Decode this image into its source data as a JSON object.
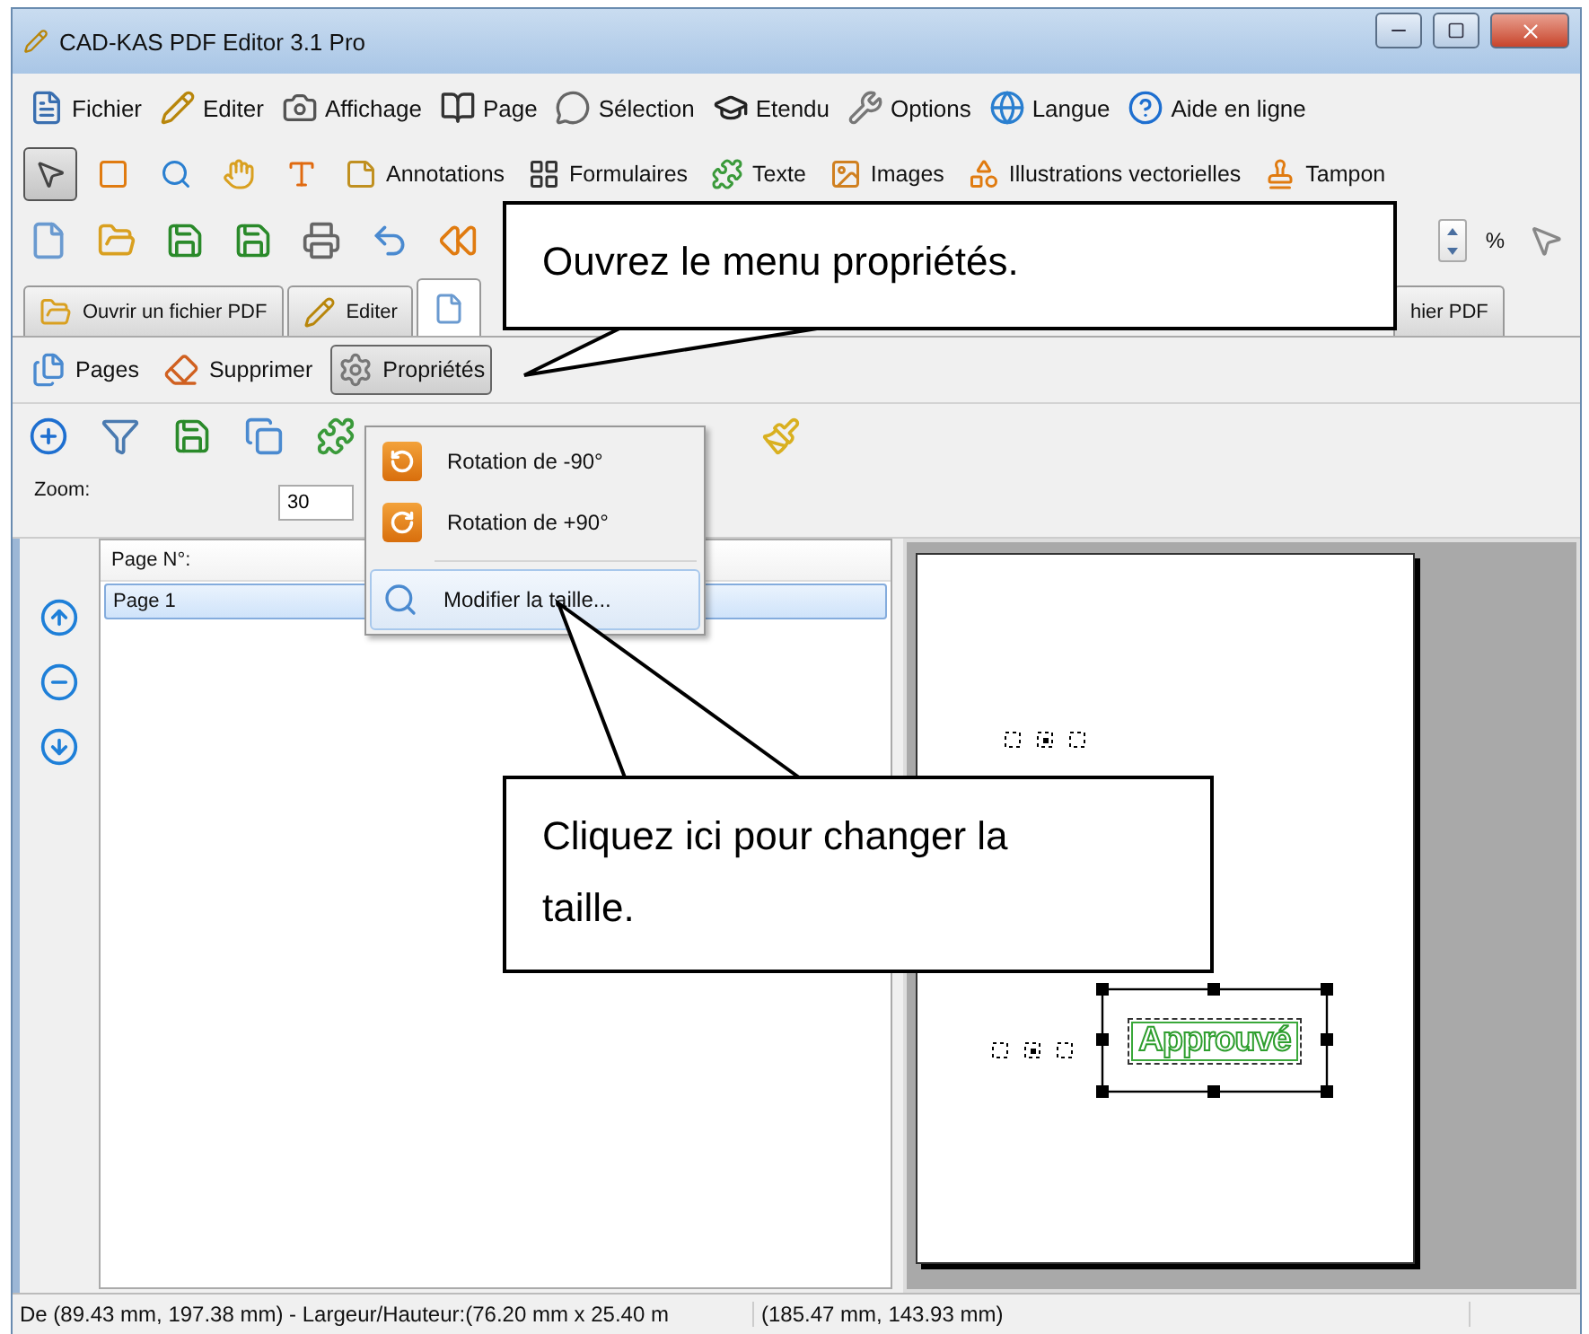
{
  "window": {
    "title": "CAD-KAS PDF Editor 3.1 Pro"
  },
  "menu_bar": [
    {
      "label": "Fichier"
    },
    {
      "label": "Editer"
    },
    {
      "label": "Affichage"
    },
    {
      "label": "Page"
    },
    {
      "label": "Sélection"
    },
    {
      "label": "Etendu"
    },
    {
      "label": "Options"
    },
    {
      "label": "Langue"
    },
    {
      "label": "Aide en ligne"
    }
  ],
  "tool_bar": {
    "tools": [
      {
        "selected": true
      },
      {
        "selected": false
      },
      {
        "selected": false
      },
      {
        "selected": false
      },
      {
        "selected": false
      }
    ],
    "buttons": [
      {
        "label": "Annotations"
      },
      {
        "label": "Formulaires"
      },
      {
        "label": "Texte"
      },
      {
        "label": "Images"
      },
      {
        "label": "Illustrations vectorielles"
      },
      {
        "label": "Tampon"
      }
    ]
  },
  "file_toolbar": {
    "zoom_unit": "%"
  },
  "tabs": [
    {
      "label": "Ouvrir un fichier PDF",
      "selected": false
    },
    {
      "label": "Editer",
      "selected": false
    },
    {
      "selected": true
    },
    {
      "label": "hier PDF",
      "selected": false
    }
  ],
  "page_toolbar": [
    {
      "label": "Pages",
      "pressed": false
    },
    {
      "label": "Supprimer",
      "pressed": false
    },
    {
      "label": "Propriétés",
      "pressed": true
    }
  ],
  "properties_menu": [
    {
      "label": "Rotation de -90°",
      "selected": false
    },
    {
      "label": "Rotation de +90°",
      "selected": false
    },
    {
      "label": "Modifier la taille...",
      "selected": true
    }
  ],
  "zoom": {
    "label": "Zoom:",
    "value": "30"
  },
  "page_list": {
    "columns": [
      "Page N°:"
    ],
    "rows": [
      {
        "cells": [
          "Page 1"
        ],
        "selected": true
      }
    ]
  },
  "document": {
    "stamp": "Approuvé"
  },
  "status_bar": [
    "De (89.43 mm, 197.38 mm) - Largeur/Hauteur:(76.20 mm x 25.40 m",
    "(185.47 mm, 143.93 mm)"
  ],
  "callouts": [
    {
      "text": "Ouvrez le menu propriétés."
    },
    {
      "text": "Cliquez ici pour changer la taille."
    }
  ]
}
